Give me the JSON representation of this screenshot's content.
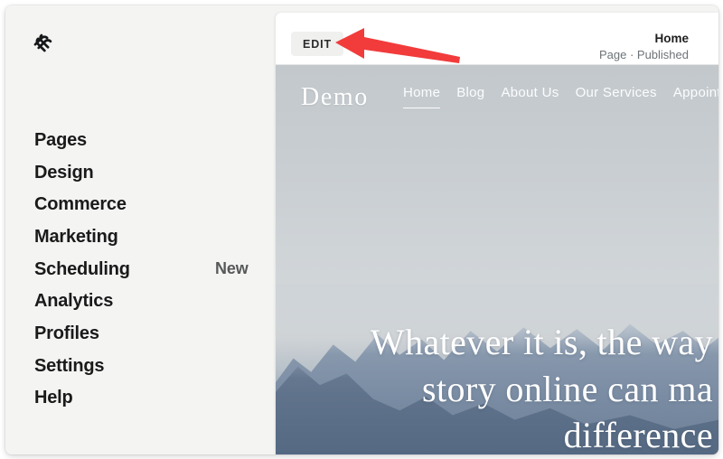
{
  "app": {
    "logo_icon": "squarespace-logo-icon",
    "accent_color": "#1a1a1a",
    "sidebar_bg": "#f4f4f3",
    "annotation_color": "#f23b3b"
  },
  "sidebar": {
    "items": [
      {
        "label": "Pages",
        "badge": ""
      },
      {
        "label": "Design",
        "badge": ""
      },
      {
        "label": "Commerce",
        "badge": ""
      },
      {
        "label": "Marketing",
        "badge": ""
      },
      {
        "label": "Scheduling",
        "badge": "New"
      },
      {
        "label": "Analytics",
        "badge": ""
      },
      {
        "label": "Profiles",
        "badge": ""
      },
      {
        "label": "Settings",
        "badge": ""
      },
      {
        "label": "Help",
        "badge": ""
      }
    ]
  },
  "panel_header": {
    "edit_label": "EDIT",
    "page_title": "Home",
    "page_status": "Page · Published"
  },
  "site_preview": {
    "logo": "Demo",
    "nav_links": [
      {
        "label": "Home",
        "active": true
      },
      {
        "label": "Blog",
        "active": false
      },
      {
        "label": "About Us",
        "active": false
      },
      {
        "label": "Our Services",
        "active": false
      },
      {
        "label": "Appointme",
        "active": false
      }
    ],
    "hero_lines": [
      "Whatever it is, the way",
      "story online can ma",
      "difference"
    ]
  },
  "annotation": {
    "type": "arrow-pointing-left",
    "target": "EDIT",
    "color": "#f23b3b"
  }
}
